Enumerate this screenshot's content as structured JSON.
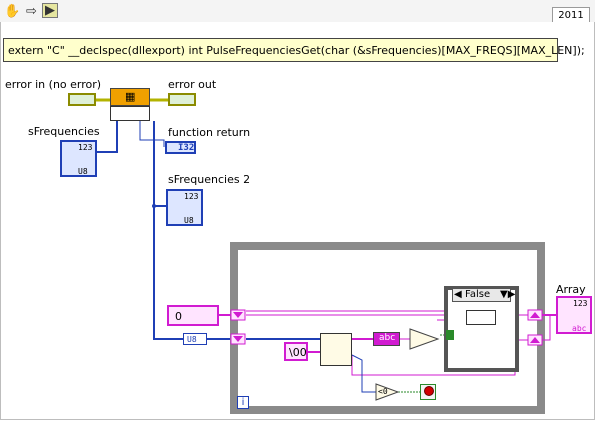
{
  "toolbar": {
    "version_label": "2011"
  },
  "comment": {
    "text": "extern \"C\" __declspec(dllexport) int PulseFrequenciesGet(char (&sFrequencies)[MAX_FREQS][MAX_LEN]);"
  },
  "labels": {
    "error_in": "error in (no error)",
    "error_out": "error out",
    "sfrequencies": "sFrequencies",
    "function_return": "function return",
    "sfrequencies2": "sFrequencies 2",
    "array": "Array"
  },
  "terminals": {
    "u8_tag": "U8",
    "i32_tag": "I32",
    "numeric_123": "123",
    "abc_tag": "abc",
    "index_i": "i",
    "constant_zero": "0",
    "constant_null": "\\00",
    "case_selector": "False",
    "compare_zero": "<0",
    "cast_u8": "U8"
  },
  "colors": {
    "error_wire": "#b3b300",
    "array_wire": "#1f3fb5",
    "string_wire": "#d11bd1",
    "bool_wire": "#2a8a2a",
    "loop_frame": "#8a8a8a"
  }
}
